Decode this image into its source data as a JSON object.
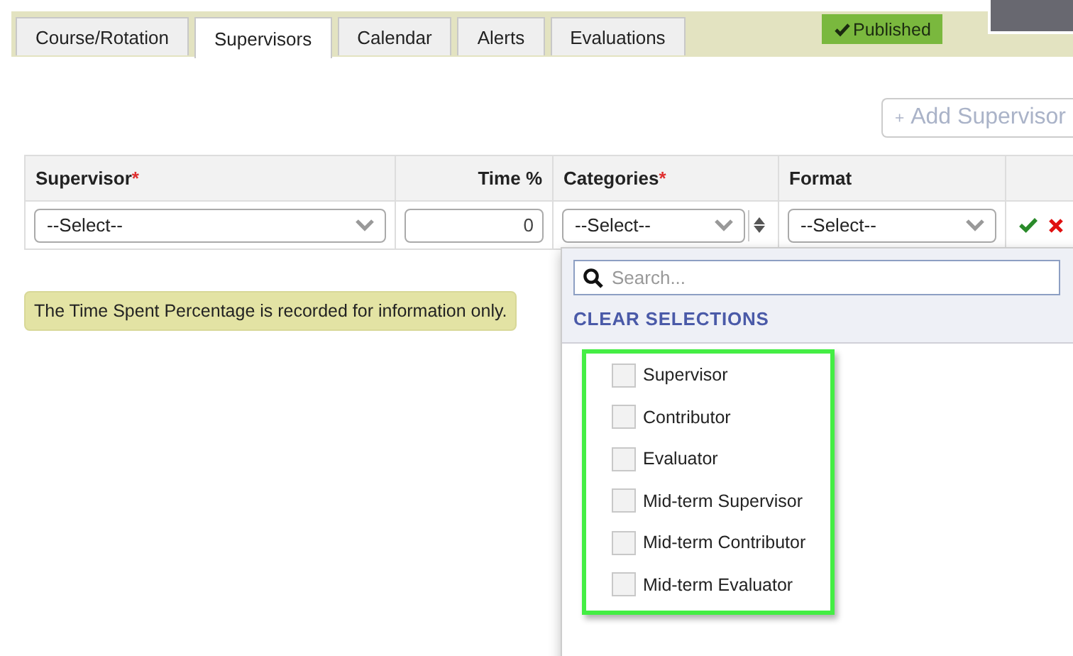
{
  "tabs": [
    {
      "label": "Course/Rotation",
      "selected": false
    },
    {
      "label": "Supervisors",
      "selected": true
    },
    {
      "label": "Calendar",
      "selected": false
    },
    {
      "label": "Alerts",
      "selected": false
    },
    {
      "label": "Evaluations",
      "selected": false
    }
  ],
  "status_badge": "Published",
  "add_button": {
    "label": "Add Supervisor",
    "disabled": true
  },
  "table": {
    "columns": [
      {
        "label": "Supervisor",
        "required_mark": "*",
        "kind": "text"
      },
      {
        "label": "Time %",
        "kind": "number"
      },
      {
        "label": "Categories",
        "required_mark": "*",
        "kind": "text"
      },
      {
        "label": "Format",
        "kind": "text"
      }
    ],
    "row": {
      "supervisor": "--Select--",
      "time": "0",
      "categories": "--Select--",
      "format": "--Select--"
    }
  },
  "note": "The Time Spent Percentage is recorded for information only.",
  "dropdown": {
    "search_placeholder": "Search...",
    "clear_label": "CLEAR SELECTIONS",
    "highlighted": true,
    "options": [
      {
        "label": "Supervisor",
        "checked": false
      },
      {
        "label": "Contributor",
        "checked": false
      },
      {
        "label": "Evaluator",
        "checked": false
      },
      {
        "label": "Mid-term Supervisor",
        "checked": false
      },
      {
        "label": "Mid-term Contributor",
        "checked": false
      },
      {
        "label": "Mid-term Evaluator",
        "checked": false
      }
    ]
  }
}
